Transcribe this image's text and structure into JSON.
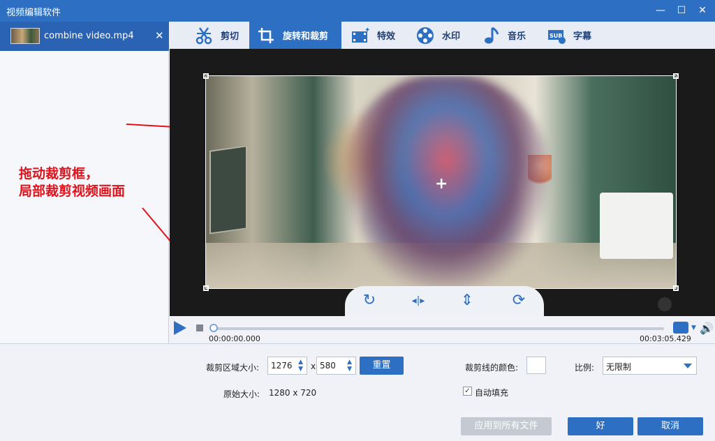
{
  "window": {
    "title": "视频编辑软件",
    "minimize_glyph": "—",
    "maximize_glyph": "☐",
    "close_glyph": "✕"
  },
  "file_panel": {
    "file_name": "combine video.mp4",
    "close_glyph": "✕"
  },
  "annotation": {
    "line1": "拖动裁剪框，",
    "line2": "局部裁剪视频画面"
  },
  "toolbar": {
    "tabs": [
      {
        "label": "剪切",
        "icon": "scissors-icon"
      },
      {
        "label": "旋转和裁剪",
        "icon": "crop-icon",
        "active": true
      },
      {
        "label": "特效",
        "icon": "film-effects-icon"
      },
      {
        "label": "水印",
        "icon": "film-reel-icon"
      },
      {
        "label": "音乐",
        "icon": "music-note-icon"
      },
      {
        "label": "字幕",
        "icon": "subtitle-icon"
      }
    ]
  },
  "preview": {
    "crosshair_glyph": "+",
    "chevron_glyph": "⌄"
  },
  "controls": {
    "rotate_glyph": "↻",
    "flip_h_glyph": "◂|▸",
    "flip_v_glyph": "⇕",
    "reset_glyph": "⟳"
  },
  "playback": {
    "current_time": "00:00:00.000",
    "total_time": "00:03:05.429",
    "progress": 0
  },
  "crop_settings": {
    "area_label": "裁剪区域大小:",
    "width": "1276",
    "times": "x",
    "height": "580",
    "reset_label": "重置",
    "original_label": "原始大小:",
    "original_value": "1280 x 720",
    "line_color_label": "裁剪线的颜色:",
    "ratio_label": "比例:",
    "ratio_value": "无限制",
    "autofill_label": "自动填充",
    "autofill_checked": true,
    "apply_all_label": "应用到所有文件",
    "ok_label": "好",
    "cancel_label": "取消"
  },
  "colors": {
    "accent": "#2d6fc2",
    "highlight_red": "#e0121b",
    "title_bar": "#2d6fc2"
  }
}
